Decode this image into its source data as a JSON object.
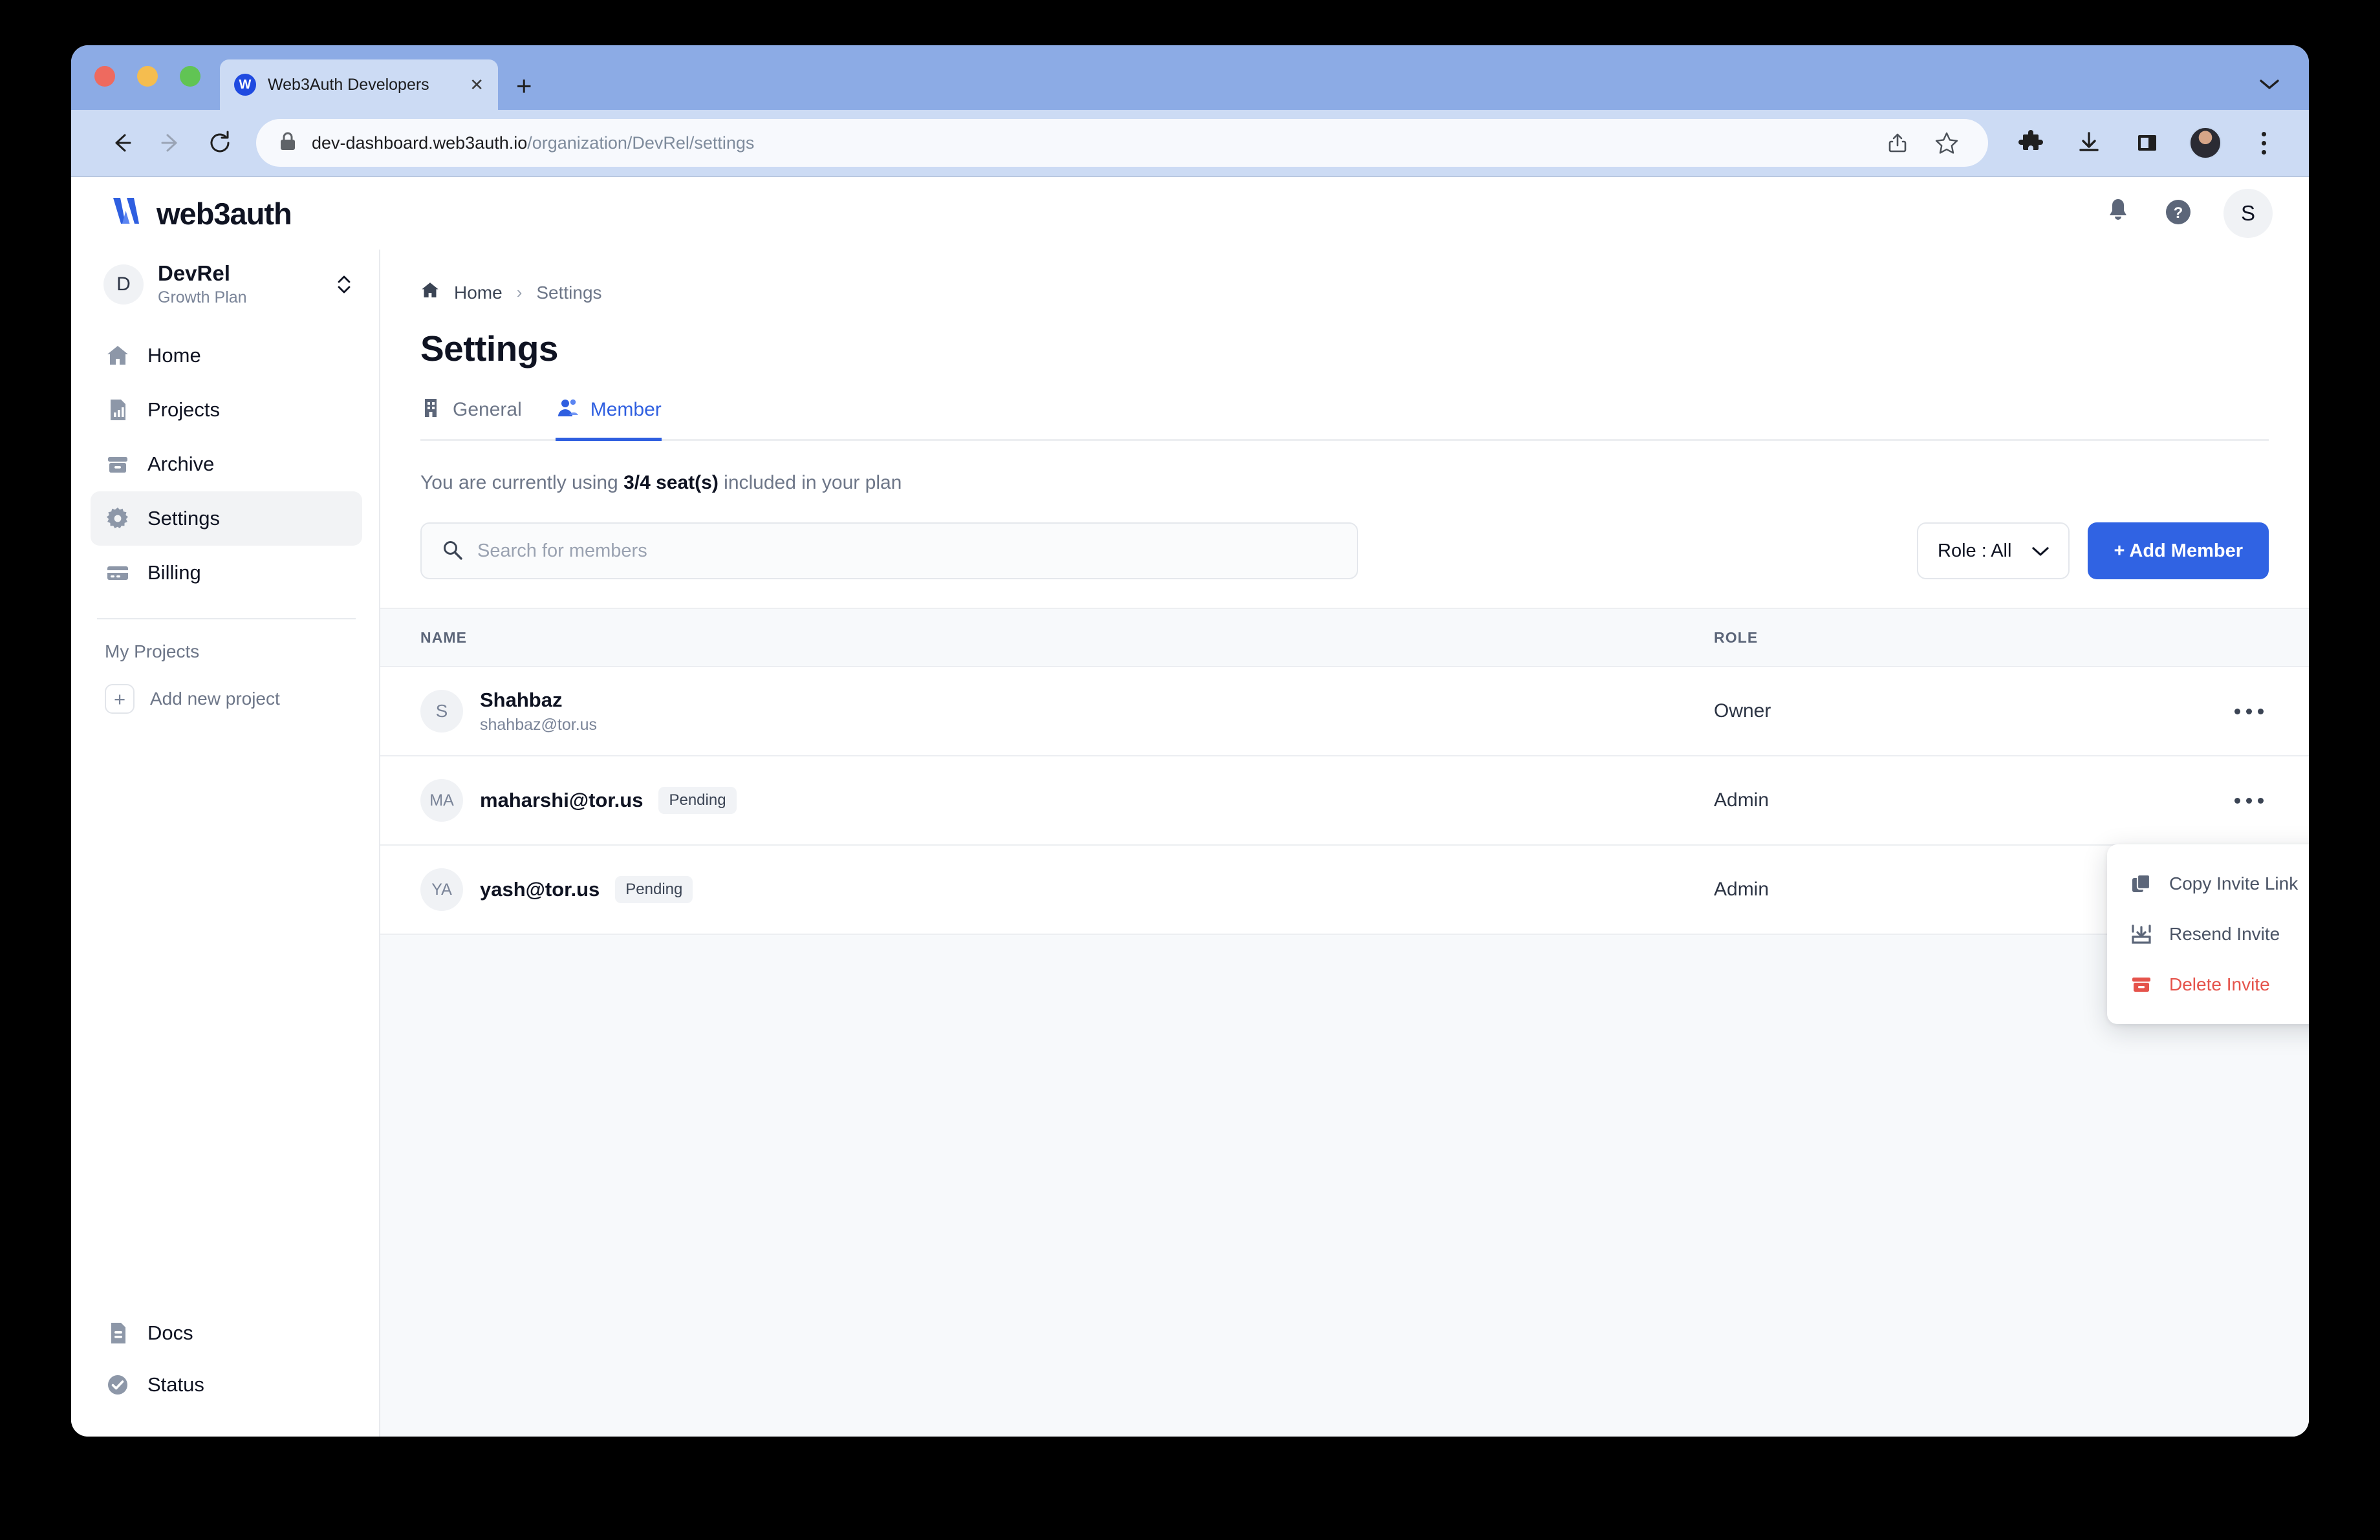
{
  "browser": {
    "tab": {
      "title": "Web3Auth Developers",
      "favicon_letter": "W",
      "close_icon": "close-icon"
    },
    "new_tab_label": "+",
    "tabstrip_chevron": "chevron-down-icon",
    "url": {
      "domain": "dev-dashboard.web3auth.io",
      "path": "/organization/DevRel/settings"
    },
    "nav": {
      "back": "back-arrow-icon",
      "forward": "forward-arrow-icon",
      "reload": "reload-icon"
    },
    "omnibox_icons": [
      "lock-icon",
      "share-icon",
      "star-icon"
    ],
    "toolbar_icons": [
      "extensions-puzzle-icon",
      "downloads-icon",
      "side-panel-icon",
      "profile-avatar",
      "chrome-menu-icon"
    ]
  },
  "app_header": {
    "brand_text": "web3auth",
    "brand_mark": "web3auth-logo",
    "notifications_icon": "bell-icon",
    "help_icon": "help-circle-icon",
    "avatar_letter": "S"
  },
  "sidebar": {
    "org": {
      "avatar_letter": "D",
      "name": "DevRel",
      "plan": "Growth Plan",
      "switcher_icon": "chevron-up-down-icon"
    },
    "items": [
      {
        "label": "Home",
        "icon": "home-icon",
        "active": false
      },
      {
        "label": "Projects",
        "icon": "projects-chart-icon",
        "active": false
      },
      {
        "label": "Archive",
        "icon": "archive-box-icon",
        "active": false
      },
      {
        "label": "Settings",
        "icon": "gear-icon",
        "active": true
      },
      {
        "label": "Billing",
        "icon": "credit-card-icon",
        "active": false
      }
    ],
    "section_label": "My Projects",
    "add_project": {
      "label": "Add new project",
      "icon": "plus-icon"
    },
    "bottom_items": [
      {
        "label": "Docs",
        "icon": "document-icon"
      },
      {
        "label": "Status",
        "icon": "check-circle-icon"
      }
    ]
  },
  "main": {
    "breadcrumb": {
      "home_icon": "home-icon",
      "home": "Home",
      "separator": "›",
      "current": "Settings"
    },
    "page_title": "Settings",
    "tabs": [
      {
        "label": "General",
        "icon": "building-icon",
        "active": false
      },
      {
        "label": "Member",
        "icon": "members-icon",
        "active": true
      }
    ],
    "seat_line": {
      "prefix": "You are currently using ",
      "value": "3/4 seat(s)",
      "suffix": " included in your plan"
    },
    "search": {
      "placeholder": "Search for members",
      "value": "",
      "icon": "search-icon"
    },
    "role_filter": {
      "label": "Role : All",
      "icon": "chevron-down-icon"
    },
    "add_member_button": "+ Add Member",
    "table": {
      "columns": [
        "NAME",
        "ROLE"
      ],
      "rows": [
        {
          "avatar": "S",
          "name": "Shahbaz",
          "email": "shahbaz@tor.us",
          "badge": "",
          "role": "Owner",
          "actions_icon": "ellipsis-horizontal-icon"
        },
        {
          "avatar": "MA",
          "name": "maharshi@tor.us",
          "email": "",
          "badge": "Pending",
          "role": "Admin",
          "actions_icon": "ellipsis-horizontal-icon"
        },
        {
          "avatar": "YA",
          "name": "yash@tor.us",
          "email": "",
          "badge": "Pending",
          "role": "Admin",
          "actions_icon": "ellipsis-horizontal-icon"
        }
      ]
    }
  },
  "context_menu": {
    "items": [
      {
        "label": "Copy Invite Link",
        "icon": "copy-icon",
        "danger": false
      },
      {
        "label": "Resend Invite",
        "icon": "resend-invite-icon",
        "danger": false
      },
      {
        "label": "Delete Invite",
        "icon": "trash-archive-icon",
        "danger": true
      }
    ]
  },
  "colors": {
    "accent_blue": "#3063e3",
    "tab_active_blue": "#2f5fe0",
    "danger_red": "#e5534b",
    "chrome_tabstrip": "#8cabe5",
    "chrome_toolbar": "#ccdbf4",
    "text_primary": "#0f1322",
    "text_muted": "#6d7688"
  }
}
